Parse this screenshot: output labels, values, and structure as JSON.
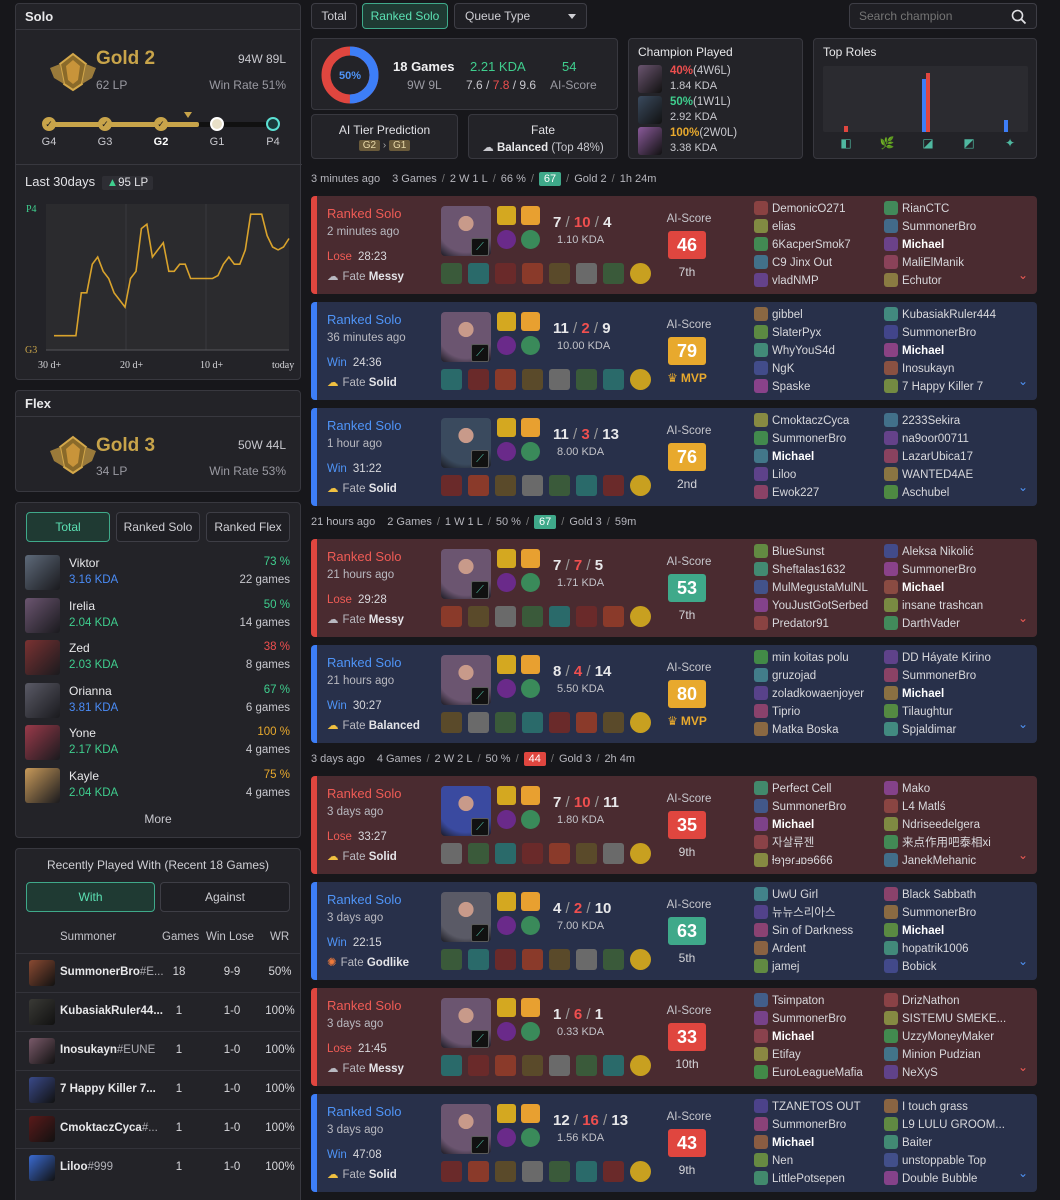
{
  "solo": {
    "header": "Solo",
    "tier": "Gold 2",
    "lp": "62 LP",
    "record": "94W 89L",
    "winrate": "Win Rate 51%",
    "steps": [
      "G4",
      "G3",
      "G2",
      "G1",
      "P4"
    ],
    "last30_label": "Last 30days",
    "last30_delta": "95 LP",
    "chart_labels": {
      "top": "P4",
      "bottom": "G3"
    },
    "x_ticks": [
      "30 d+",
      "20 d+",
      "10 d+",
      "today"
    ]
  },
  "flex": {
    "header": "Flex",
    "tier": "Gold 3",
    "lp": "34 LP",
    "record": "50W 44L",
    "winrate": "Win Rate 53%"
  },
  "champ_tabs": [
    "Total",
    "Ranked Solo",
    "Ranked Flex"
  ],
  "champions": [
    {
      "name": "Viktor",
      "kda": "3.16 KDA",
      "wr": "73 %",
      "games": "22 games",
      "kda_color": "#4a8cf7",
      "wr_color": "#3fce8e",
      "color": "#5e6a7a"
    },
    {
      "name": "Irelia",
      "kda": "2.04 KDA",
      "wr": "50 %",
      "games": "14 games",
      "kda_color": "#3fce8e",
      "wr_color": "#3fce8e",
      "color": "#6b5570"
    },
    {
      "name": "Zed",
      "kda": "2.03 KDA",
      "wr": "38 %",
      "games": "8 games",
      "kda_color": "#3fce8e",
      "wr_color": "#ef4f4f",
      "color": "#7a3232"
    },
    {
      "name": "Orianna",
      "kda": "3.81 KDA",
      "wr": "67 %",
      "games": "6 games",
      "kda_color": "#4a8cf7",
      "wr_color": "#3fce8e",
      "color": "#5a5a66"
    },
    {
      "name": "Yone",
      "kda": "2.17 KDA",
      "wr": "100 %",
      "games": "4 games",
      "kda_color": "#3fce8e",
      "wr_color": "#e8a92d",
      "color": "#9a3a4a"
    },
    {
      "name": "Kayle",
      "kda": "2.04 KDA",
      "wr": "75 %",
      "games": "4 games",
      "kda_color": "#3fce8e",
      "wr_color": "#e8a92d",
      "color": "#c89a5a"
    }
  ],
  "more": "More",
  "recent": {
    "title": "Recently Played With (Recent 18 Games)",
    "tabs": [
      "With",
      "Against"
    ],
    "headers": [
      "Summoner",
      "Games",
      "Win Lose",
      "WR"
    ],
    "rows": [
      {
        "name": "SummonerBro",
        "tag": "#E...",
        "games": "18",
        "wl": "9-9",
        "wr": "50%",
        "color": "#8a4a32"
      },
      {
        "name": "KubasiakRuler44...",
        "tag": "",
        "games": "1",
        "wl": "1-0",
        "wr": "100%",
        "color": "#3a3a36"
      },
      {
        "name": "Inosukayn",
        "tag": "#EUNE",
        "games": "1",
        "wl": "1-0",
        "wr": "100%",
        "color": "#7a5a6a"
      },
      {
        "name": "7 Happy Killer 7...",
        "tag": "",
        "games": "1",
        "wl": "1-0",
        "wr": "100%",
        "color": "#3a4a8a"
      },
      {
        "name": "CmoktaczCyca",
        "tag": "#...",
        "games": "1",
        "wl": "1-0",
        "wr": "100%",
        "color": "#5a1a1a"
      },
      {
        "name": "Liloo",
        "tag": "#999",
        "games": "1",
        "wl": "1-0",
        "wr": "100%",
        "color": "#3a6ad0"
      }
    ]
  },
  "top_tabs": {
    "total": "Total",
    "ranked": "Ranked Solo",
    "queue": "Queue Type"
  },
  "search_placeholder": "Search champion",
  "summary": {
    "pct": "50%",
    "games": "18 Games",
    "wl": "9W 9L",
    "kda": "2.21 KDA",
    "k": "7.6",
    "d": "7.8",
    "a": "9.6",
    "ai_score": "54",
    "ai_label": "AI-Score",
    "win_fraction": 0.5
  },
  "tier_pred": {
    "title": "AI Tier Prediction",
    "from": "G2",
    "to": "G1"
  },
  "fate": {
    "title": "Fate",
    "value": "Balanced",
    "suffix": "(Top 48%)"
  },
  "champ_played": {
    "title": "Champion Played",
    "items": [
      {
        "pct": "40%",
        "rec": "(4W6L)",
        "kda": "1.84 KDA",
        "pct_color": "#ef4f4f",
        "color": "#6b5570"
      },
      {
        "pct": "50%",
        "rec": "(1W1L)",
        "kda": "2.92 KDA",
        "pct_color": "#3fce8e",
        "color": "#3a4a5e"
      },
      {
        "pct": "100%",
        "rec": "(2W0L)",
        "kda": "3.38 KDA",
        "pct_color": "#e8a92d",
        "color": "#8a5a9a"
      }
    ]
  },
  "top_roles": {
    "title": "Top Roles",
    "roles": [
      "top",
      "jungle",
      "mid",
      "adc",
      "support"
    ],
    "values": [
      {
        "red": 0.1,
        "blue": 0
      },
      {
        "red": 0,
        "blue": 0
      },
      {
        "red": 0.95,
        "blue": 0.85
      },
      {
        "red": 0,
        "blue": 0
      },
      {
        "red": 0,
        "blue": 0.2
      }
    ]
  },
  "groups": [
    {
      "ago": "3 minutes ago",
      "games": "3 Games",
      "wl": "2 W 1 L",
      "pct": "66 %",
      "badge": "67",
      "badge_color": "#3fa98a",
      "tier": "Gold 2",
      "dur": "1h 24m"
    },
    {
      "ago": "21 hours ago",
      "games": "2 Games",
      "wl": "1 W 1 L",
      "pct": "50 %",
      "badge": "67",
      "badge_color": "#3fa98a",
      "tier": "Gold 3",
      "dur": "59m"
    },
    {
      "ago": "3 days ago",
      "games": "4 Games",
      "wl": "2 W 2 L",
      "pct": "50 %",
      "badge": "44",
      "badge_color": "#e0463f",
      "tier": "Gold 3",
      "dur": "2h 4m"
    }
  ],
  "matches": [
    {
      "res": "lose",
      "type": "Ranked Solo",
      "ago": "2 minutes ago",
      "label": "Lose",
      "dur": "28:23",
      "fate": "Messy",
      "k": "7",
      "d": "10",
      "a": "4",
      "kda": "1.10 KDA",
      "score": "46",
      "score_color": "#e0463f",
      "place": "7th",
      "mvp": false,
      "champ_color": "#6b5570",
      "left": [
        "DemonicO271",
        "elias",
        "6KacperSmok7",
        "C9 Jinx Out",
        "vladNMP"
      ],
      "right": [
        "RianCTC",
        "SummonerBro",
        "Michael",
        "MaliElManik",
        "Echutor"
      ],
      "me_side": "right",
      "me_idx": 2
    },
    {
      "res": "win",
      "type": "Ranked Solo",
      "ago": "36 minutes ago",
      "label": "Win",
      "dur": "24:36",
      "fate": "Solid",
      "k": "11",
      "d": "2",
      "a": "9",
      "kda": "10.00 KDA",
      "score": "79",
      "score_color": "#e8a92d",
      "place": "MVP",
      "mvp": true,
      "champ_color": "#6b5570",
      "left": [
        "gibbel",
        "SlaterPyx",
        "WhyYouS4d",
        "NgK",
        "Spaske"
      ],
      "right": [
        "KubasiakRuler444",
        "SummonerBro",
        "Michael",
        "Inosukayn",
        "7 Happy Killer 7"
      ],
      "me_side": "right",
      "me_idx": 2
    },
    {
      "res": "win",
      "type": "Ranked Solo",
      "ago": "1 hour ago",
      "label": "Win",
      "dur": "31:22",
      "fate": "Solid",
      "k": "11",
      "d": "3",
      "a": "13",
      "kda": "8.00 KDA",
      "score": "76",
      "score_color": "#e8a92d",
      "place": "2nd",
      "mvp": false,
      "champ_color": "#3a4a5e",
      "left": [
        "CmoktaczCyca",
        "SummonerBro",
        "Michael",
        "Liloo",
        "Ewok227"
      ],
      "right": [
        "2233Sekira",
        "na9oor00711",
        "LazarUbica17",
        "WANTED4AE",
        "Aschubel"
      ],
      "me_side": "left",
      "me_idx": 2
    },
    {
      "res": "lose",
      "type": "Ranked Solo",
      "ago": "21 hours ago",
      "label": "Lose",
      "dur": "29:28",
      "fate": "Messy",
      "k": "7",
      "d": "7",
      "a": "5",
      "kda": "1.71 KDA",
      "score": "53",
      "score_color": "#3fa98a",
      "place": "7th",
      "mvp": false,
      "champ_color": "#6b5570",
      "left": [
        "BlueSunst",
        "Sheftalas1632",
        "MulMegustaMulNL",
        "YouJustGotSerbed",
        "Predator91"
      ],
      "right": [
        "Aleksa Nikolić",
        "SummonerBro",
        "Michael",
        "insane trashcan",
        "DarthVader"
      ],
      "me_side": "right",
      "me_idx": 2
    },
    {
      "res": "win",
      "type": "Ranked Solo",
      "ago": "21 hours ago",
      "label": "Win",
      "dur": "30:27",
      "fate": "Balanced",
      "k": "8",
      "d": "4",
      "a": "14",
      "kda": "5.50 KDA",
      "score": "80",
      "score_color": "#e8a92d",
      "place": "MVP",
      "mvp": true,
      "champ_color": "#6b5570",
      "left": [
        "min koitas polu",
        "gruzojad",
        "zoladkowaenjoyer",
        "Tiprio",
        "Matka Boska"
      ],
      "right": [
        "DD Háyate Kirino",
        "SummonerBro",
        "Michael",
        "Tilaughtur",
        "Spjaldimar"
      ],
      "me_side": "right",
      "me_idx": 2
    },
    {
      "res": "lose",
      "type": "Ranked Solo",
      "ago": "3 days ago",
      "label": "Lose",
      "dur": "33:27",
      "fate": "Solid",
      "k": "7",
      "d": "10",
      "a": "11",
      "kda": "1.80 KDA",
      "score": "35",
      "score_color": "#e0463f",
      "place": "9th",
      "mvp": false,
      "champ_color": "#3a4aa0",
      "left": [
        "Perfect Cell",
        "SummonerBro",
        "Michael",
        "자살류젠",
        "ƚɘɿɘɾⅎɒɘ666"
      ],
      "right": [
        "Mako",
        "L4 Matlś",
        "Ndriseedelgera",
        "来点作用吧泰相xi",
        "JanekMehanic"
      ],
      "me_side": "left",
      "me_idx": 2
    },
    {
      "res": "win",
      "type": "Ranked Solo",
      "ago": "3 days ago",
      "label": "Win",
      "dur": "22:15",
      "fate": "Godlike",
      "k": "4",
      "d": "2",
      "a": "10",
      "kda": "7.00 KDA",
      "score": "63",
      "score_color": "#3fa98a",
      "place": "5th",
      "mvp": false,
      "champ_color": "#5a5a66",
      "left": [
        "UwU Girl",
        "뉴뉴스리아스",
        "Sin of Darkness",
        "Ardent",
        "jamej"
      ],
      "right": [
        "Black Sabbath",
        "SummonerBro",
        "Michael",
        "hopatrik1006",
        "Bobick"
      ],
      "me_side": "right",
      "me_idx": 2
    },
    {
      "res": "lose",
      "type": "Ranked Solo",
      "ago": "3 days ago",
      "label": "Lose",
      "dur": "21:45",
      "fate": "Messy",
      "k": "1",
      "d": "6",
      "a": "1",
      "kda": "0.33 KDA",
      "score": "33",
      "score_color": "#e0463f",
      "place": "10th",
      "mvp": false,
      "champ_color": "#6b5570",
      "left": [
        "Tsimpaton",
        "SummonerBro",
        "Michael",
        "Etifay",
        "EuroLeagueMafia"
      ],
      "right": [
        "DrizNathon",
        "SISTEMU SMEKE...",
        "UzzyMoneyMaker",
        "Minion Pudzian",
        "NeXyS"
      ],
      "me_side": "left",
      "me_idx": 2
    },
    {
      "res": "win",
      "type": "Ranked Solo",
      "ago": "3 days ago",
      "label": "Win",
      "dur": "47:08",
      "fate": "Solid",
      "k": "12",
      "d": "16",
      "a": "13",
      "kda": "1.56 KDA",
      "score": "43",
      "score_color": "#e0463f",
      "place": "9th",
      "mvp": false,
      "champ_color": "#6b5570",
      "left": [
        "TZANETOS OUT",
        "SummonerBro",
        "Michael",
        "Nen",
        "LittlePotsepen"
      ],
      "right": [
        "I touch grass",
        "L9 LULU GROOM...",
        "Baiter",
        "unstoppable Top",
        "Double Bubble"
      ],
      "me_side": "left",
      "me_idx": 2
    }
  ],
  "colors": {
    "win": "#3d7ef7",
    "lose": "#e0463f",
    "accent": "#3fa98a",
    "gold": "#c8a44a"
  },
  "lp_series": [
    0.1,
    0.1,
    0.1,
    0.1,
    0.1,
    0.4,
    0.4,
    0.6,
    0.65,
    0.55,
    0.5,
    0.4,
    0.35,
    0.3,
    0.5,
    0.55,
    0.85,
    0.88,
    0.65,
    0.7,
    0.75,
    0.55,
    0.55,
    0.6,
    0.6,
    0.5,
    0.5,
    0.5,
    0.5,
    0.5,
    0.52,
    0.6,
    0.65,
    0.6,
    0.6,
    0.7,
    0.95,
    0.95,
    0.95,
    0.8,
    0.72,
    0.7,
    0.72,
    0.78
  ]
}
